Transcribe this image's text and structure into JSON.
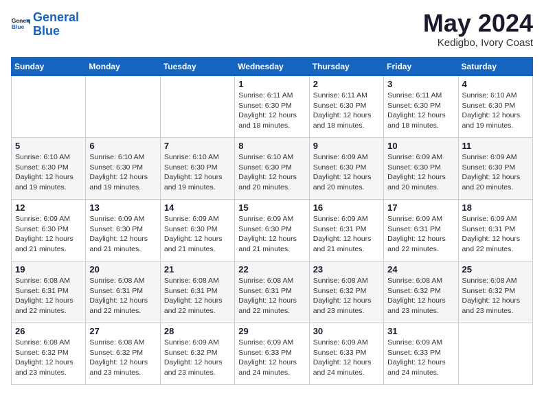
{
  "header": {
    "logo_line1": "General",
    "logo_line2": "Blue",
    "month": "May 2024",
    "location": "Kedigbo, Ivory Coast"
  },
  "weekdays": [
    "Sunday",
    "Monday",
    "Tuesday",
    "Wednesday",
    "Thursday",
    "Friday",
    "Saturday"
  ],
  "weeks": [
    [
      {
        "day": "",
        "info": ""
      },
      {
        "day": "",
        "info": ""
      },
      {
        "day": "",
        "info": ""
      },
      {
        "day": "1",
        "info": "Sunrise: 6:11 AM\nSunset: 6:30 PM\nDaylight: 12 hours\nand 18 minutes."
      },
      {
        "day": "2",
        "info": "Sunrise: 6:11 AM\nSunset: 6:30 PM\nDaylight: 12 hours\nand 18 minutes."
      },
      {
        "day": "3",
        "info": "Sunrise: 6:11 AM\nSunset: 6:30 PM\nDaylight: 12 hours\nand 18 minutes."
      },
      {
        "day": "4",
        "info": "Sunrise: 6:10 AM\nSunset: 6:30 PM\nDaylight: 12 hours\nand 19 minutes."
      }
    ],
    [
      {
        "day": "5",
        "info": "Sunrise: 6:10 AM\nSunset: 6:30 PM\nDaylight: 12 hours\nand 19 minutes."
      },
      {
        "day": "6",
        "info": "Sunrise: 6:10 AM\nSunset: 6:30 PM\nDaylight: 12 hours\nand 19 minutes."
      },
      {
        "day": "7",
        "info": "Sunrise: 6:10 AM\nSunset: 6:30 PM\nDaylight: 12 hours\nand 19 minutes."
      },
      {
        "day": "8",
        "info": "Sunrise: 6:10 AM\nSunset: 6:30 PM\nDaylight: 12 hours\nand 20 minutes."
      },
      {
        "day": "9",
        "info": "Sunrise: 6:09 AM\nSunset: 6:30 PM\nDaylight: 12 hours\nand 20 minutes."
      },
      {
        "day": "10",
        "info": "Sunrise: 6:09 AM\nSunset: 6:30 PM\nDaylight: 12 hours\nand 20 minutes."
      },
      {
        "day": "11",
        "info": "Sunrise: 6:09 AM\nSunset: 6:30 PM\nDaylight: 12 hours\nand 20 minutes."
      }
    ],
    [
      {
        "day": "12",
        "info": "Sunrise: 6:09 AM\nSunset: 6:30 PM\nDaylight: 12 hours\nand 21 minutes."
      },
      {
        "day": "13",
        "info": "Sunrise: 6:09 AM\nSunset: 6:30 PM\nDaylight: 12 hours\nand 21 minutes."
      },
      {
        "day": "14",
        "info": "Sunrise: 6:09 AM\nSunset: 6:30 PM\nDaylight: 12 hours\nand 21 minutes."
      },
      {
        "day": "15",
        "info": "Sunrise: 6:09 AM\nSunset: 6:30 PM\nDaylight: 12 hours\nand 21 minutes."
      },
      {
        "day": "16",
        "info": "Sunrise: 6:09 AM\nSunset: 6:31 PM\nDaylight: 12 hours\nand 21 minutes."
      },
      {
        "day": "17",
        "info": "Sunrise: 6:09 AM\nSunset: 6:31 PM\nDaylight: 12 hours\nand 22 minutes."
      },
      {
        "day": "18",
        "info": "Sunrise: 6:09 AM\nSunset: 6:31 PM\nDaylight: 12 hours\nand 22 minutes."
      }
    ],
    [
      {
        "day": "19",
        "info": "Sunrise: 6:08 AM\nSunset: 6:31 PM\nDaylight: 12 hours\nand 22 minutes."
      },
      {
        "day": "20",
        "info": "Sunrise: 6:08 AM\nSunset: 6:31 PM\nDaylight: 12 hours\nand 22 minutes."
      },
      {
        "day": "21",
        "info": "Sunrise: 6:08 AM\nSunset: 6:31 PM\nDaylight: 12 hours\nand 22 minutes."
      },
      {
        "day": "22",
        "info": "Sunrise: 6:08 AM\nSunset: 6:31 PM\nDaylight: 12 hours\nand 22 minutes."
      },
      {
        "day": "23",
        "info": "Sunrise: 6:08 AM\nSunset: 6:32 PM\nDaylight: 12 hours\nand 23 minutes."
      },
      {
        "day": "24",
        "info": "Sunrise: 6:08 AM\nSunset: 6:32 PM\nDaylight: 12 hours\nand 23 minutes."
      },
      {
        "day": "25",
        "info": "Sunrise: 6:08 AM\nSunset: 6:32 PM\nDaylight: 12 hours\nand 23 minutes."
      }
    ],
    [
      {
        "day": "26",
        "info": "Sunrise: 6:08 AM\nSunset: 6:32 PM\nDaylight: 12 hours\nand 23 minutes."
      },
      {
        "day": "27",
        "info": "Sunrise: 6:08 AM\nSunset: 6:32 PM\nDaylight: 12 hours\nand 23 minutes."
      },
      {
        "day": "28",
        "info": "Sunrise: 6:09 AM\nSunset: 6:32 PM\nDaylight: 12 hours\nand 23 minutes."
      },
      {
        "day": "29",
        "info": "Sunrise: 6:09 AM\nSunset: 6:33 PM\nDaylight: 12 hours\nand 24 minutes."
      },
      {
        "day": "30",
        "info": "Sunrise: 6:09 AM\nSunset: 6:33 PM\nDaylight: 12 hours\nand 24 minutes."
      },
      {
        "day": "31",
        "info": "Sunrise: 6:09 AM\nSunset: 6:33 PM\nDaylight: 12 hours\nand 24 minutes."
      },
      {
        "day": "",
        "info": ""
      }
    ]
  ]
}
